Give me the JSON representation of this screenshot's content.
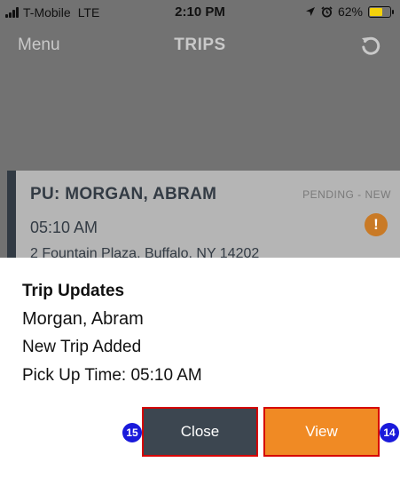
{
  "status_bar": {
    "carrier": "T-Mobile",
    "network": "LTE",
    "time": "2:10 PM",
    "battery_text": "62%",
    "battery_level": 0.62,
    "icons": [
      "signal-icon",
      "location-arrow-icon",
      "alarm-icon",
      "battery-icon"
    ]
  },
  "nav": {
    "menu_label": "Menu",
    "title": "TRIPS",
    "refresh_icon": "refresh-icon"
  },
  "trip_card": {
    "pickup": "PU: MORGAN, ABRAM",
    "status": "PENDING - NEW",
    "time": "05:10 AM",
    "alert_glyph": "!",
    "address": "2 Fountain Plaza, Buffalo, NY 14202"
  },
  "modal": {
    "title": "Trip Updates",
    "name": "Morgan, Abram",
    "event": "New Trip Added",
    "pickup_time": "Pick Up Time: 05:10 AM",
    "close_label": "Close",
    "view_label": "View",
    "close_step": "15",
    "view_step": "14"
  },
  "colors": {
    "overlay": "#727272",
    "card_accent": "#313a43",
    "close_button": "#3c4650",
    "view_button": "#f08a24",
    "highlight_border": "#d60000",
    "step_badge": "#1a1adb"
  }
}
